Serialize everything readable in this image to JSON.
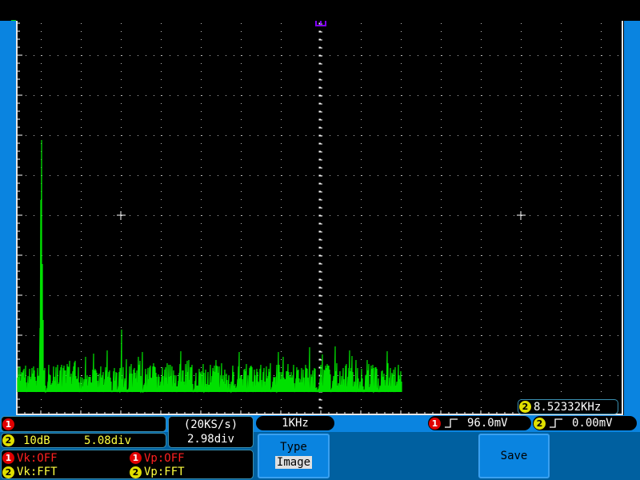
{
  "colors": {
    "trace": "#00e000",
    "panel": "#0060a0",
    "bar": "#0a84e0",
    "ch1": "#e00000",
    "ch2": "#e0e000",
    "trigger_marker": "#8000ff"
  },
  "trigger_marker_icon": "trigger-position-icon",
  "freq_readout": {
    "channel": "2",
    "value": "8.52332KHz"
  },
  "ch1": {
    "badge": "1",
    "text": ""
  },
  "ch2": {
    "badge": "2",
    "scale": "10dB",
    "position": "5.08div"
  },
  "timebase": {
    "rate": "(20KS/s)",
    "position": "2.98div"
  },
  "cursors": {
    "ch1_vk": "Vk:OFF",
    "ch1_vp": "Vp:OFF",
    "ch2_vk": "Vk:FFT",
    "ch2_vp": "Vp:FFT",
    "badge1": "1",
    "badge2": "2"
  },
  "span": "1KHz",
  "trigger1": {
    "badge": "1",
    "level": "96.0mV",
    "edge_icon": "rising-edge-icon"
  },
  "trigger2": {
    "badge": "2",
    "level": "0.00mV",
    "edge_icon": "rising-edge-icon"
  },
  "menu": {
    "type_label": "Type",
    "type_value": "Image",
    "save_label": "Save"
  }
}
